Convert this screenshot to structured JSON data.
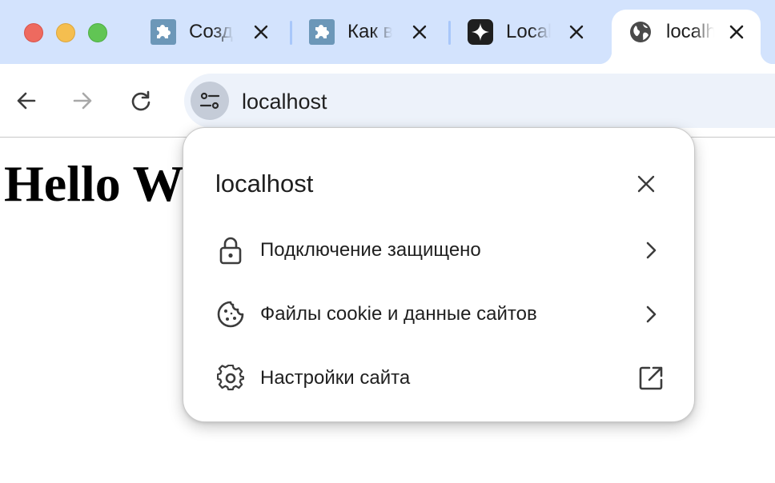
{
  "tabs": [
    {
      "title": "Созд",
      "icon": "extension-puzzle-icon"
    },
    {
      "title": "Как в",
      "icon": "extension-puzzle-icon"
    },
    {
      "title": "Local",
      "icon": "sparkle-icon"
    },
    {
      "title": "localhost",
      "icon": "globe-icon",
      "active": true
    }
  ],
  "omnibox": {
    "text": "localhost"
  },
  "page": {
    "heading": "Hello World"
  },
  "site_info": {
    "title": "localhost",
    "items": [
      {
        "label": "Подключение защищено",
        "icon": "lock-icon",
        "trailing": "chevron-right-icon"
      },
      {
        "label": "Файлы cookie и данные сайтов",
        "icon": "cookie-icon",
        "trailing": "chevron-right-icon"
      },
      {
        "label": "Настройки сайта",
        "icon": "settings-gear-icon",
        "trailing": "open-in-new-icon"
      }
    ]
  },
  "colors": {
    "tabstrip": "#d3e3fd",
    "omnibox": "#edf2fa",
    "close": "#ee6a5f",
    "minimize": "#f5be4f",
    "maximize": "#61c554"
  }
}
